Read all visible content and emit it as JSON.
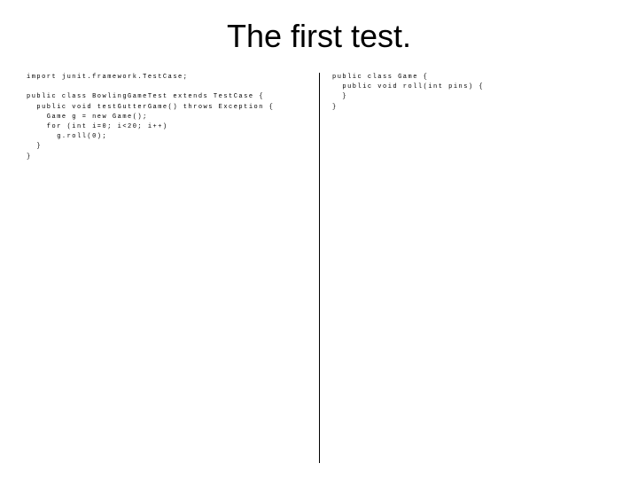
{
  "title": "The first test.",
  "code_left": "import junit.framework.TestCase;\n\npublic class BowlingGameTest extends TestCase {\n  public void testGutterGame() throws Exception {\n    Game g = new Game();\n    for (int i=0; i<20; i++)\n      g.roll(0);\n  }\n}",
  "code_right": "public class Game {\n  public void roll(int pins) {\n  }\n}"
}
